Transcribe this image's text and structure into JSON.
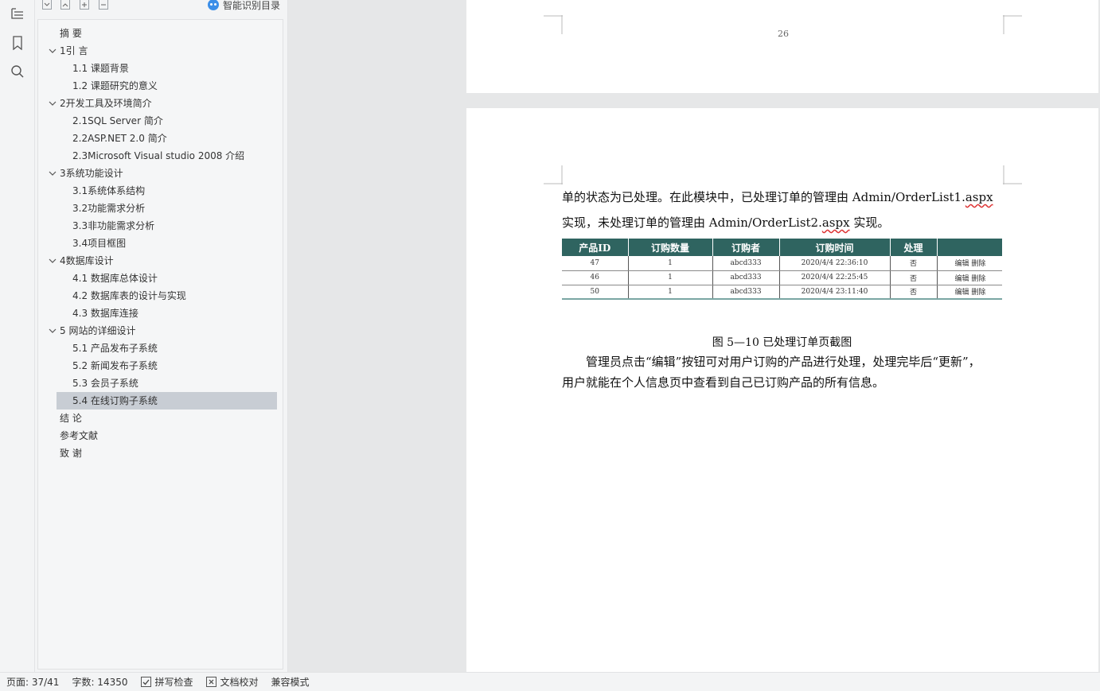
{
  "nav": {
    "smart_toc_label": "智能识别目录",
    "toc": [
      {
        "label": "摘  要",
        "level": 1,
        "expandable": false,
        "selected": false
      },
      {
        "label": "1引  言",
        "level": 1,
        "expandable": true,
        "selected": false
      },
      {
        "label": "1.1 课题背景",
        "level": 2,
        "expandable": false,
        "selected": false
      },
      {
        "label": "1.2  课题研究的意义",
        "level": 2,
        "expandable": false,
        "selected": false
      },
      {
        "label": "2开发工具及环境简介",
        "level": 1,
        "expandable": true,
        "selected": false
      },
      {
        "label": "2.1SQL Server  简介",
        "level": 2,
        "expandable": false,
        "selected": false
      },
      {
        "label": "2.2ASP.NET 2.0 简介",
        "level": 2,
        "expandable": false,
        "selected": false
      },
      {
        "label": "2.3Microsoft Visual studio 2008  介绍",
        "level": 2,
        "expandable": false,
        "selected": false
      },
      {
        "label": "3系统功能设计",
        "level": 1,
        "expandable": true,
        "selected": false
      },
      {
        "label": "3.1系统体系结构",
        "level": 2,
        "expandable": false,
        "selected": false
      },
      {
        "label": "3.2功能需求分析",
        "level": 2,
        "expandable": false,
        "selected": false
      },
      {
        "label": "3.3非功能需求分析",
        "level": 2,
        "expandable": false,
        "selected": false
      },
      {
        "label": "3.4项目框图",
        "level": 2,
        "expandable": false,
        "selected": false
      },
      {
        "label": "4数据库设计",
        "level": 1,
        "expandable": true,
        "selected": false
      },
      {
        "label": "4.1 数据库总体设计",
        "level": 2,
        "expandable": false,
        "selected": false
      },
      {
        "label": "4.2 数据库表的设计与实现",
        "level": 2,
        "expandable": false,
        "selected": false
      },
      {
        "label": "4.3  数据库连接",
        "level": 2,
        "expandable": false,
        "selected": false
      },
      {
        "label": "5 网站的详细设计",
        "level": 1,
        "expandable": true,
        "selected": false
      },
      {
        "label": "5.1 产品发布子系统",
        "level": 2,
        "expandable": false,
        "selected": false
      },
      {
        "label": "5.2 新闻发布子系统",
        "level": 2,
        "expandable": false,
        "selected": false
      },
      {
        "label": "5.3  会员子系统",
        "level": 2,
        "expandable": false,
        "selected": false
      },
      {
        "label": "5.4 在线订购子系统",
        "level": 2,
        "expandable": false,
        "selected": true
      },
      {
        "label": "结  论",
        "level": 1,
        "expandable": false,
        "selected": false
      },
      {
        "label": "参考文献",
        "level": 1,
        "expandable": false,
        "selected": false
      },
      {
        "label": "致  谢",
        "level": 1,
        "expandable": false,
        "selected": false
      }
    ]
  },
  "document": {
    "page_number": "26",
    "line1_text": "单的状态为已处理。在此模块中，已处理订单的管理由 Admin/OrderList1.",
    "line1_underlined": "aspx",
    "line2_text_a": "实现，未处理订单的管理由 Admin/OrderList2.",
    "line2_underlined": "aspx",
    "line2_text_b": " 实现。",
    "table": {
      "headers": [
        "产品ID",
        "订购数量",
        "订购者",
        "订购时间",
        "处理",
        ""
      ],
      "rows": [
        [
          "47",
          "1",
          "abcd333",
          "2020/4/4 22:36:10",
          "否",
          "编辑 删除"
        ],
        [
          "46",
          "1",
          "abcd333",
          "2020/4/4 22:25:45",
          "否",
          "编辑 删除"
        ],
        [
          "50",
          "1",
          "abcd333",
          "2020/4/4 23:11:40",
          "否",
          "编辑 删除"
        ]
      ]
    },
    "caption": "图 5—10  已处理订单页截图",
    "paragraph_line1": "管理员点击“编辑”按钮可对用户订购的产品进行处理，处理完毕后“更新”，",
    "paragraph_line2": "用户就能在个人信息页中查看到自己已订购产品的所有信息。"
  },
  "status": {
    "page": "页面: 37/41",
    "words": "字数: 14350",
    "spell_check": "拼写检查",
    "doc_proof": "文档校对",
    "compat_mode": "兼容模式"
  },
  "colors": {
    "table_header": "#2f6460",
    "selection": "#c8cdd4",
    "smart_icon": "#3b8ee8"
  }
}
